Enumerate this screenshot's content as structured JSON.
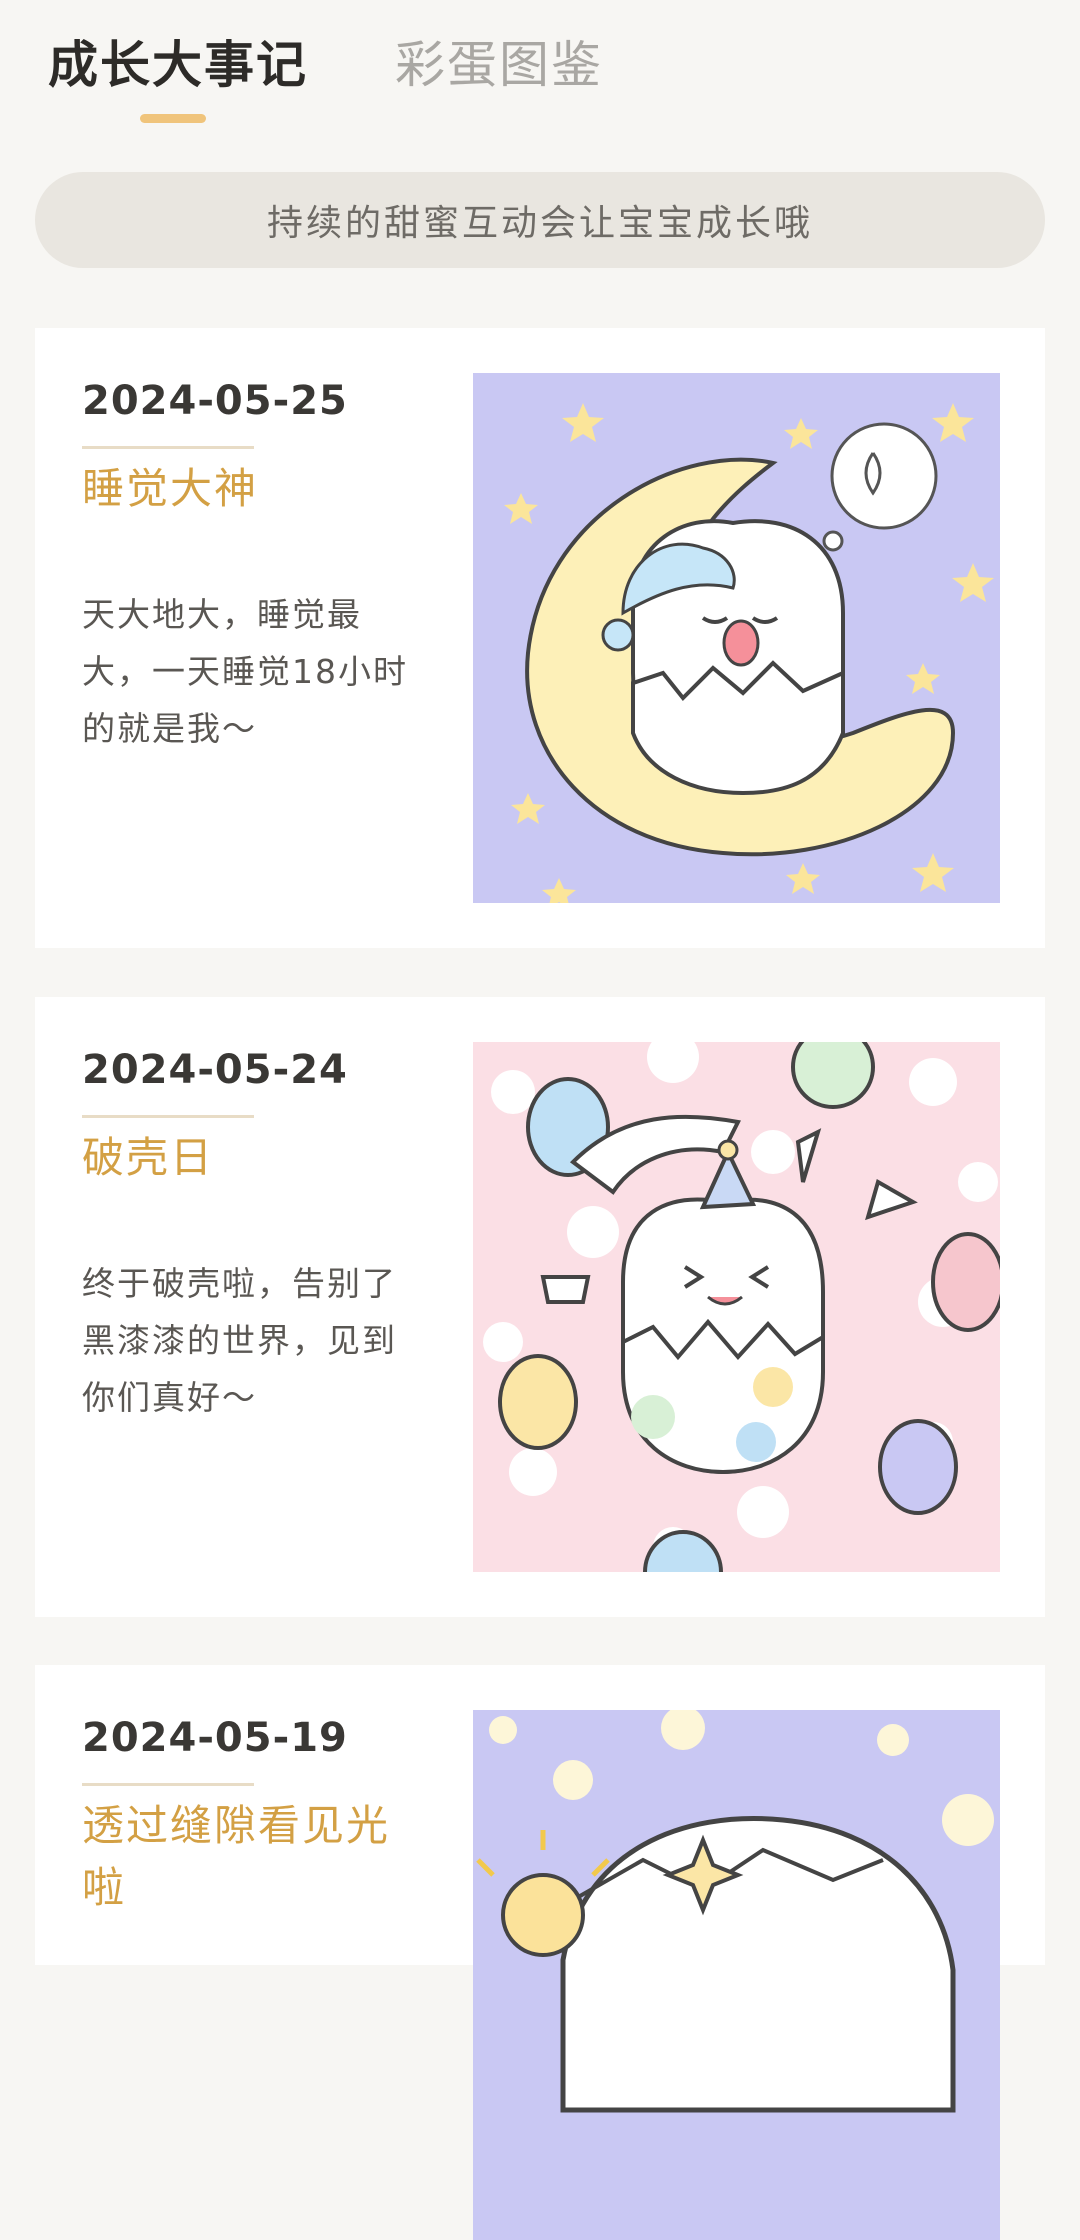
{
  "tabs": [
    {
      "label": "成长大事记",
      "active": true
    },
    {
      "label": "彩蛋图鉴",
      "active": false
    }
  ],
  "hint": "持续的甜蜜互动会让宝宝成长哦",
  "colors": {
    "accent": "#d3a044",
    "indicator": "#f0c47b",
    "background": "#f7f6f3"
  },
  "milestones": [
    {
      "date": "2024-05-25",
      "title": "睡觉大神",
      "desc": "天大地大，睡觉最大，一天睡觉18小时的就是我～",
      "illustration": "sleeping-egg-on-moon"
    },
    {
      "date": "2024-05-24",
      "title": "破壳日",
      "desc": "终于破壳啦，告别了黑漆漆的世界，见到你们真好～",
      "illustration": "hatching-egg-party"
    },
    {
      "date": "2024-05-19",
      "title": "透过缝隙看见光啦",
      "desc": "",
      "illustration": "egg-with-crack-light"
    }
  ]
}
